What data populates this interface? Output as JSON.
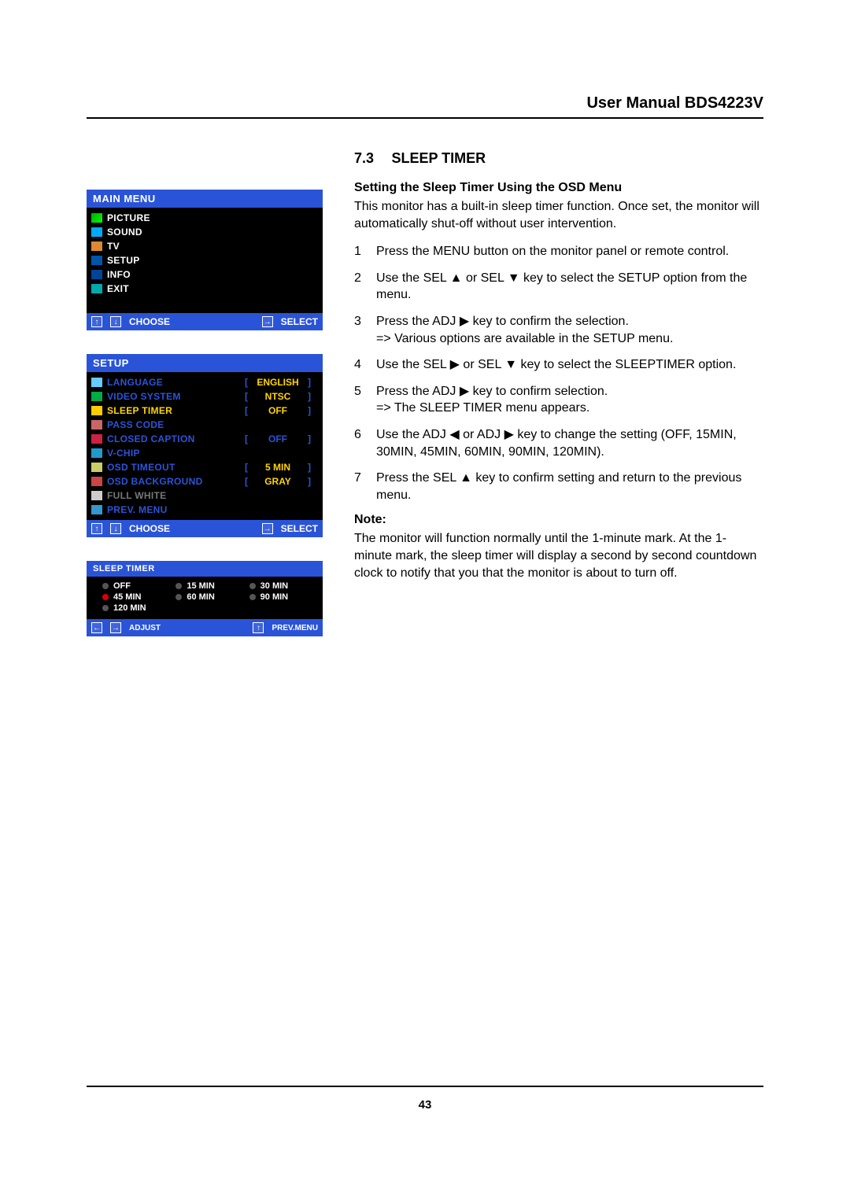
{
  "header": {
    "title": "User Manual BDS4223V"
  },
  "page_number": "43",
  "mainMenu": {
    "title": "MAIN  MENU",
    "items": [
      {
        "label": "PICTURE",
        "icon": "ic-pic"
      },
      {
        "label": "SOUND",
        "icon": "ic-snd"
      },
      {
        "label": "TV",
        "icon": "ic-tv"
      },
      {
        "label": "SETUP",
        "icon": "ic-set"
      },
      {
        "label": "INFO",
        "icon": "ic-inf"
      },
      {
        "label": "EXIT",
        "icon": "ic-ext"
      }
    ],
    "footer": {
      "choose": "CHOOSE",
      "select": "SELECT"
    }
  },
  "setupMenu": {
    "title": "SETUP",
    "items": [
      {
        "label": "LANGUAGE",
        "icon": "ic-lang",
        "value": "ENGLISH",
        "mode": "bracket"
      },
      {
        "label": "VIDEO  SYSTEM",
        "icon": "ic-vid",
        "value": "NTSC",
        "mode": "bracket"
      },
      {
        "label": "SLEEP  TIMER",
        "icon": "ic-slp",
        "value": "OFF",
        "mode": "bracket",
        "highlight": true
      },
      {
        "label": "PASS  CODE",
        "icon": "ic-pas",
        "value": "",
        "mode": "none"
      },
      {
        "label": "CLOSED  CAPTION",
        "icon": "ic-cc",
        "value": "OFF",
        "mode": "bracket",
        "valueBlue": true
      },
      {
        "label": "V-CHIP",
        "icon": "ic-vch",
        "value": "",
        "mode": "none"
      },
      {
        "label": "OSD  TIMEOUT",
        "icon": "ic-osdt",
        "value": "5 MIN",
        "mode": "bracket"
      },
      {
        "label": "OSD  BACKGROUND",
        "icon": "ic-osdb",
        "value": "GRAY",
        "mode": "bracket"
      },
      {
        "label": "FULL  WHITE",
        "icon": "ic-fw",
        "value": "",
        "mode": "none",
        "dim": true
      },
      {
        "label": "PREV.  MENU",
        "icon": "ic-prev",
        "value": "",
        "mode": "none"
      }
    ],
    "footer": {
      "choose": "CHOOSE",
      "select": "SELECT"
    }
  },
  "sleepTimerMenu": {
    "title": "SLEEP  TIMER",
    "options": [
      {
        "label": "OFF",
        "sel": false
      },
      {
        "label": "15 MIN",
        "sel": false
      },
      {
        "label": "30 MIN",
        "sel": false
      },
      {
        "label": "45 MIN",
        "sel": true
      },
      {
        "label": "60 MIN",
        "sel": false
      },
      {
        "label": "90 MIN",
        "sel": false
      },
      {
        "label": "120 MIN",
        "sel": false
      }
    ],
    "footer": {
      "adjust": "ADJUST",
      "prev": "PREV.MENU"
    }
  },
  "section": {
    "num": "7.3",
    "title": "SLEEP TIMER",
    "subhead": "Setting the Sleep Timer Using the OSD Menu",
    "intro": "This monitor has a built-in sleep timer function. Once set, the monitor will automatically shut-off without user intervention.",
    "steps": [
      "Press the MENU button on the monitor panel or remote control.",
      "Use the SEL ▲ or SEL ▼ key to select the SETUP option from the menu.",
      "Press the ADJ ▶ key to confirm the selection.\n=> Various options are available in the SETUP menu.",
      "Use  the SEL ▶ or SEL ▼ key to select the SLEEPTIMER option.",
      "Press the ADJ ▶  key to confirm selection.\n=> The SLEEP TIMER menu appears.",
      "Use the ADJ ◀ or ADJ ▶  key to change the setting (OFF, 15MIN, 30MIN, 45MIN, 60MIN, 90MIN, 120MIN).",
      " Press the SEL ▲ key to confirm setting and return to the previous menu."
    ],
    "noteLabel": "Note:",
    "note": "The monitor will function normally until the 1-minute mark. At the 1-minute mark, the sleep timer will display a second by second countdown clock to notify that you that the monitor is about to turn off."
  }
}
